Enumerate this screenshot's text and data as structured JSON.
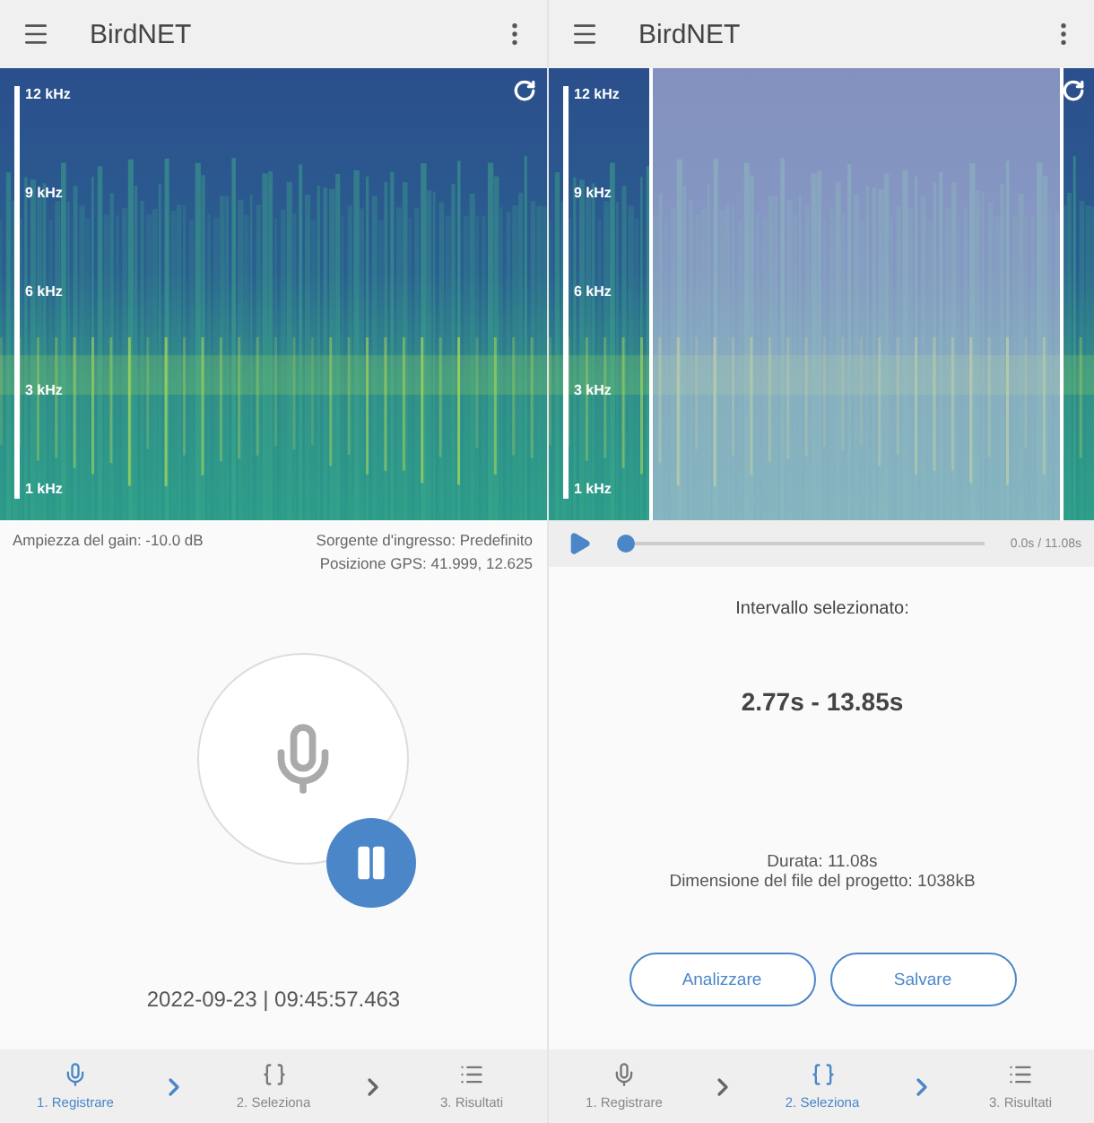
{
  "screens": [
    {
      "kind": "record",
      "title": "BirdNET",
      "axis_labels": [
        "12 kHz",
        "9 kHz",
        "6 kHz",
        "3 kHz",
        "1 kHz"
      ],
      "gain": "Ampiezza del gain: -10.0 dB",
      "source": "Sorgente d'ingresso: Predefinito",
      "gps": "Posizione GPS: 41.999, 12.625",
      "recording": true,
      "timestamp": "2022-09-23 | 09:45:57.463",
      "steps": [
        {
          "label": "1. Registrare",
          "selected": true
        },
        {
          "label": "2. Seleziona",
          "selected": false
        },
        {
          "label": "3. Risultati",
          "selected": false
        }
      ]
    },
    {
      "kind": "select",
      "title": "BirdNET",
      "axis_labels": [
        "12 kHz",
        "9 kHz",
        "6 kHz",
        "3 kHz",
        "1 kHz"
      ],
      "playing": false,
      "level": 0,
      "time": "0.0s / 11.08s",
      "interval_label": "Intervallo selezionato:",
      "interval": "2.77s - 13.85s",
      "duration": "Durata: 11.08s",
      "file_size": "Dimensione del file del progetto: 1038kB",
      "buttons": [
        "Analizzare",
        "Salvare"
      ],
      "steps": [
        {
          "label": "1. Registrare",
          "selected": false
        },
        {
          "label": "2. Seleziona",
          "selected": true
        },
        {
          "label": "3. Risultati",
          "selected": false
        }
      ]
    }
  ]
}
